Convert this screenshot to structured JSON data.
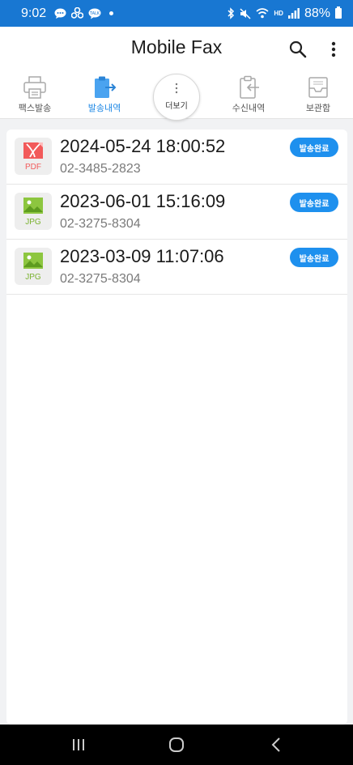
{
  "status_bar": {
    "time": "9:02",
    "left_icons": [
      "chat-icon",
      "pinwheel-icon",
      "talk-icon"
    ],
    "right_icons": [
      "bluetooth-icon",
      "mute-icon",
      "wifi-icon",
      "hd-icon",
      "signal-icon"
    ],
    "hd_label": "HD",
    "battery": "88%"
  },
  "app_bar": {
    "title": "Mobile Fax"
  },
  "tabs": [
    {
      "label": "팩스발송",
      "icon": "printer-icon",
      "active": false
    },
    {
      "label": "발송내역",
      "icon": "clipboard-send-icon",
      "active": true
    },
    {
      "label": "더보기",
      "icon": "more-vertical-icon",
      "active": false
    },
    {
      "label": "수신내역",
      "icon": "clipboard-receive-icon",
      "active": false
    },
    {
      "label": "보관함",
      "icon": "inbox-tray-icon",
      "active": false
    }
  ],
  "fax_list": [
    {
      "datetime": "2024-05-24 18:00:52",
      "number": "02-3485-2823",
      "file_type": "PDF",
      "status": "발송완료"
    },
    {
      "datetime": "2023-06-01 15:16:09",
      "number": "02-3275-8304",
      "file_type": "JPG",
      "status": "발송완료"
    },
    {
      "datetime": "2023-03-09 11:07:06",
      "number": "02-3275-8304",
      "file_type": "JPG",
      "status": "발송완료"
    }
  ],
  "colors": {
    "accent": "#1e88e5",
    "badge": "#1e90ee",
    "status_bar": "#1877d2",
    "pdf": "#f25a5a",
    "jpg": "#8dc63f"
  },
  "nav_bar": {
    "buttons": [
      "recent-apps-icon",
      "home-icon",
      "back-icon"
    ]
  }
}
